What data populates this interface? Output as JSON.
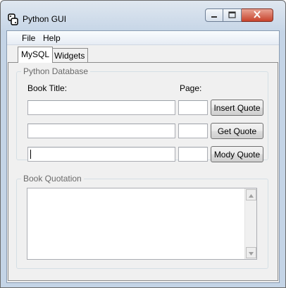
{
  "window": {
    "title": "Python GUI"
  },
  "menu": {
    "file": "File",
    "help": "Help"
  },
  "tabs": [
    {
      "label": "MySQL",
      "active": true
    },
    {
      "label": "Widgets",
      "active": false
    }
  ],
  "database_group": {
    "title": "Python Database",
    "book_title_label": "Book Title:",
    "page_label": "Page:",
    "rows": [
      {
        "title_value": "",
        "page_value": "",
        "button": "Insert Quote"
      },
      {
        "title_value": "",
        "page_value": "",
        "button": "Get Quote"
      },
      {
        "title_value": "",
        "page_value": "",
        "button": "Mody Quote"
      }
    ]
  },
  "quotation_group": {
    "title": "Book Quotation",
    "text": ""
  },
  "colors": {
    "frame": "#c4d4e6",
    "close_button": "#c8432c",
    "group_border": "#d5dfe5",
    "group_label": "#6a6a6a"
  },
  "icons": {
    "app": "python-icon",
    "minimize": "minimize-icon",
    "maximize": "maximize-icon",
    "close": "close-icon",
    "scroll_up": "scroll-up-arrow-icon",
    "scroll_down": "scroll-down-arrow-icon"
  }
}
